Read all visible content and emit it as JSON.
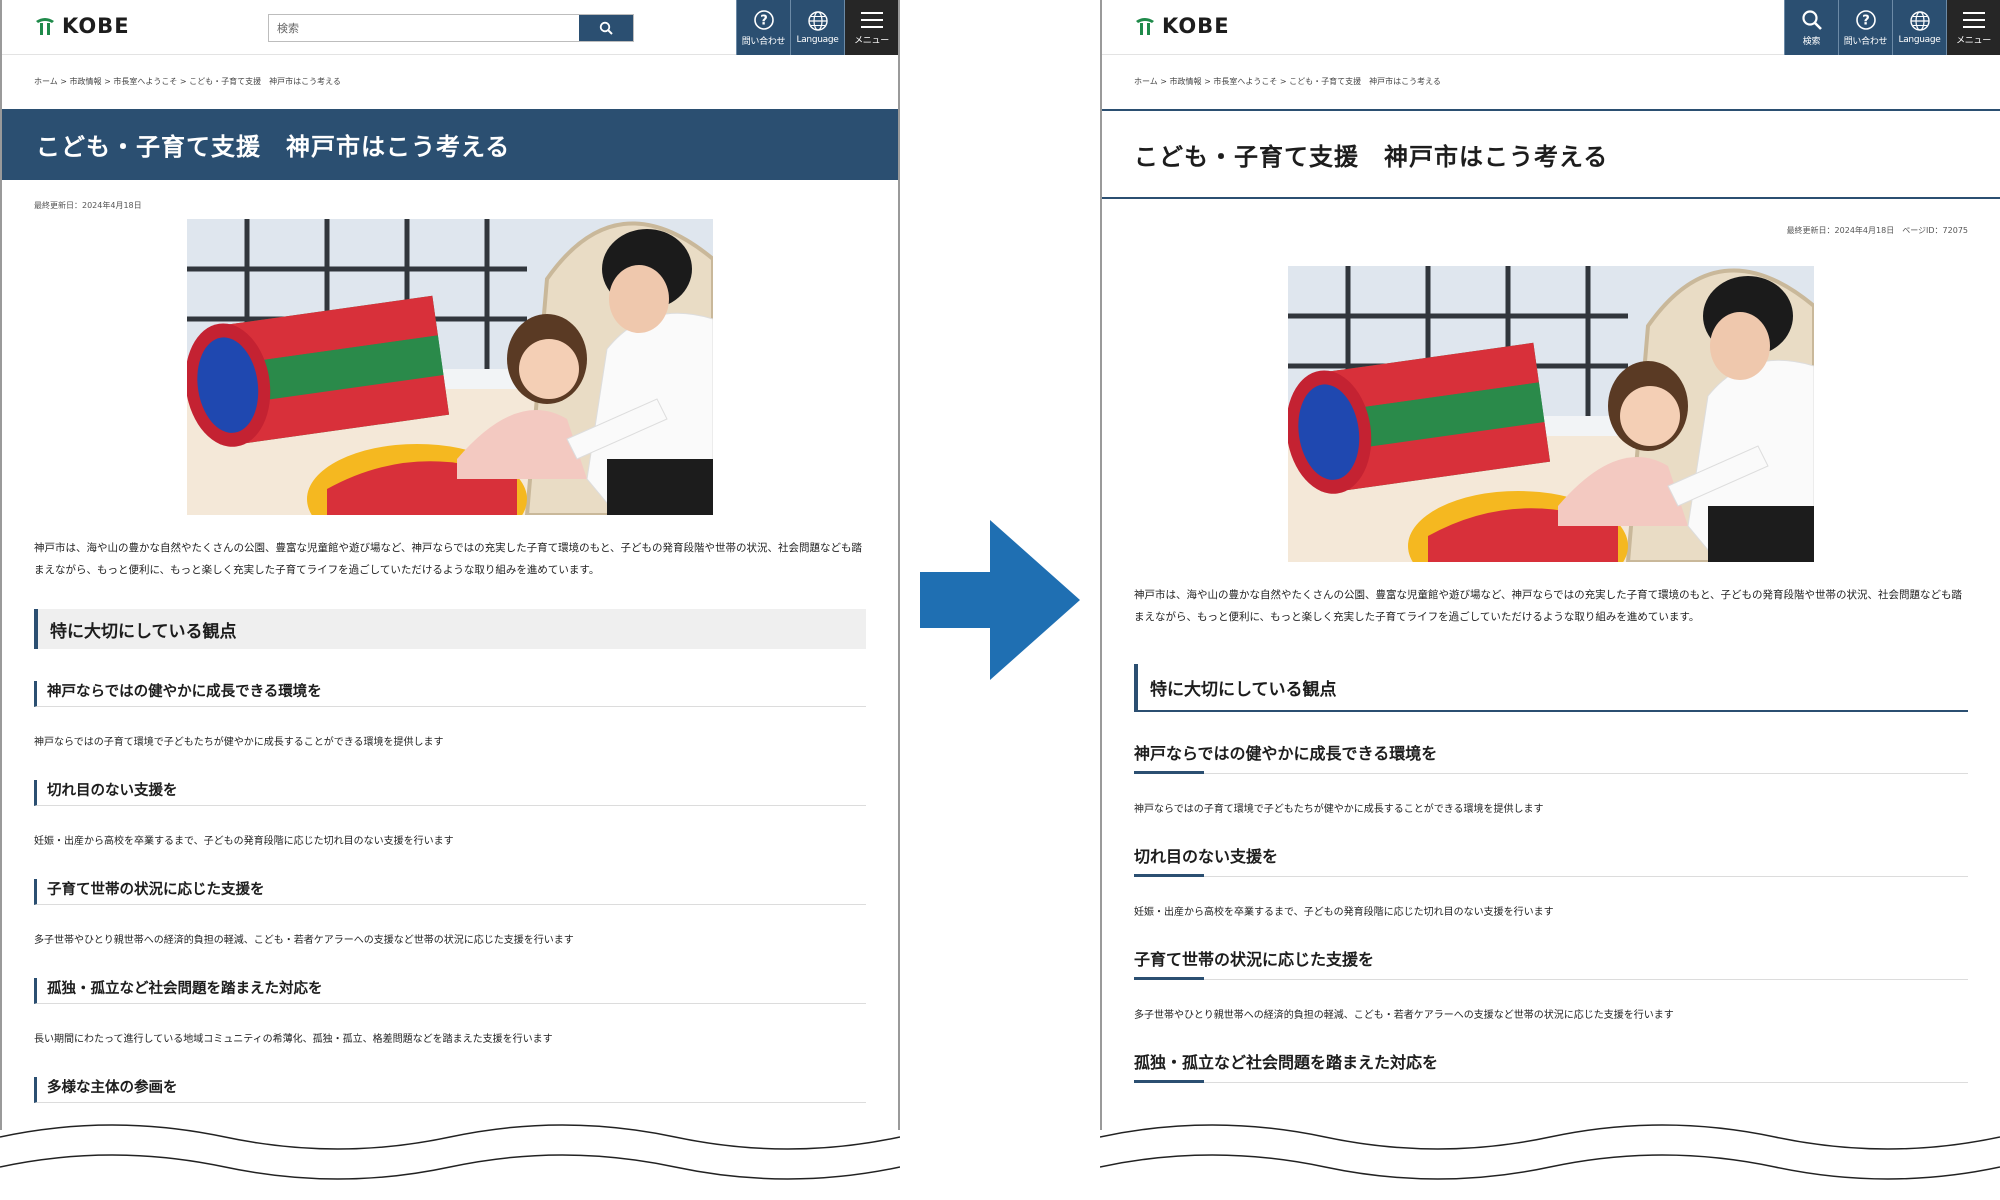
{
  "header": {
    "logo_text": "KOBE",
    "search_placeholder": "検索",
    "tools": {
      "search": "検索",
      "contact": "問い合わせ",
      "language": "Language",
      "menu": "メニュー"
    }
  },
  "left": {
    "breadcrumb": "ホーム > 市政情報 > 市長室へようこそ > こども・子育て支援　神戸市はこう考える",
    "title": "こども・子育て支援　神戸市はこう考える",
    "updated": "最終更新日：2024年4月18日",
    "intro": "神戸市は、海や山の豊かな自然やたくさんの公園、豊富な児童館や遊び場など、神戸ならではの充実した子育て環境のもと、子どもの発育段階や世帯の状況、社会問題なども踏まえながら、もっと便利に、もっと楽しく充実した子育てライフを過ごしていただけるような取り組みを進めています。",
    "section_heading": "特に大切にしている観点",
    "items": [
      {
        "heading": "神戸ならではの健やかに成長できる環境を",
        "text": "神戸ならではの子育て環境で子どもたちが健やかに成長することができる環境を提供します"
      },
      {
        "heading": "切れ目のない支援を",
        "text": "妊娠・出産から高校を卒業するまで、子どもの発育段階に応じた切れ目のない支援を行います"
      },
      {
        "heading": "子育て世帯の状況に応じた支援を",
        "text": "多子世帯やひとり親世帯への経済的負担の軽減、こども・若者ケアラーへの支援など世帯の状況に応じた支援を行います"
      },
      {
        "heading": "孤独・孤立など社会問題を踏まえた対応を",
        "text": "長い期間にわたって進行している地域コミュニティの希薄化、孤独・孤立、格差問題などを踏まえた支援を行います"
      },
      {
        "heading": "多様な主体の参画を",
        "text": ""
      }
    ]
  },
  "right": {
    "breadcrumb": "ホーム > 市政情報 > 市長室へようこそ > こども・子育て支援　神戸市はこう考える",
    "title": "こども・子育て支援　神戸市はこう考える",
    "updated": "最終更新日：2024年4月18日　ページID：72075",
    "intro": "神戸市は、海や山の豊かな自然やたくさんの公園、豊富な児童館や遊び場など、神戸ならではの充実した子育て環境のもと、子どもの発育段階や世帯の状況、社会問題なども踏まえながら、もっと便利に、もっと楽しく充実した子育てライフを過ごしていただけるような取り組みを進めています。",
    "section_heading": "特に大切にしている観点",
    "items": [
      {
        "heading": "神戸ならではの健やかに成長できる環境を",
        "text": "神戸ならではの子育て環境で子どもたちが健やかに成長することができる環境を提供します"
      },
      {
        "heading": "切れ目のない支援を",
        "text": "妊娠・出産から高校を卒業するまで、子どもの発育段階に応じた切れ目のない支援を行います"
      },
      {
        "heading": "子育て世帯の状況に応じた支援を",
        "text": "多子世帯やひとり親世帯への経済的負担の軽減、こども・若者ケアラーへの支援など世帯の状況に応じた支援を行います"
      },
      {
        "heading": "孤独・孤立など社会問題を踏まえた対応を",
        "text": ""
      }
    ]
  },
  "colors": {
    "brand_navy": "#2b4f71",
    "arrow_blue": "#1f6fb2",
    "menu_dark": "#262626",
    "logo_green": "#1f8a4a"
  },
  "icons": [
    "search-icon",
    "question-icon",
    "globe-icon",
    "hamburger-icon",
    "kobe-logo-icon"
  ]
}
